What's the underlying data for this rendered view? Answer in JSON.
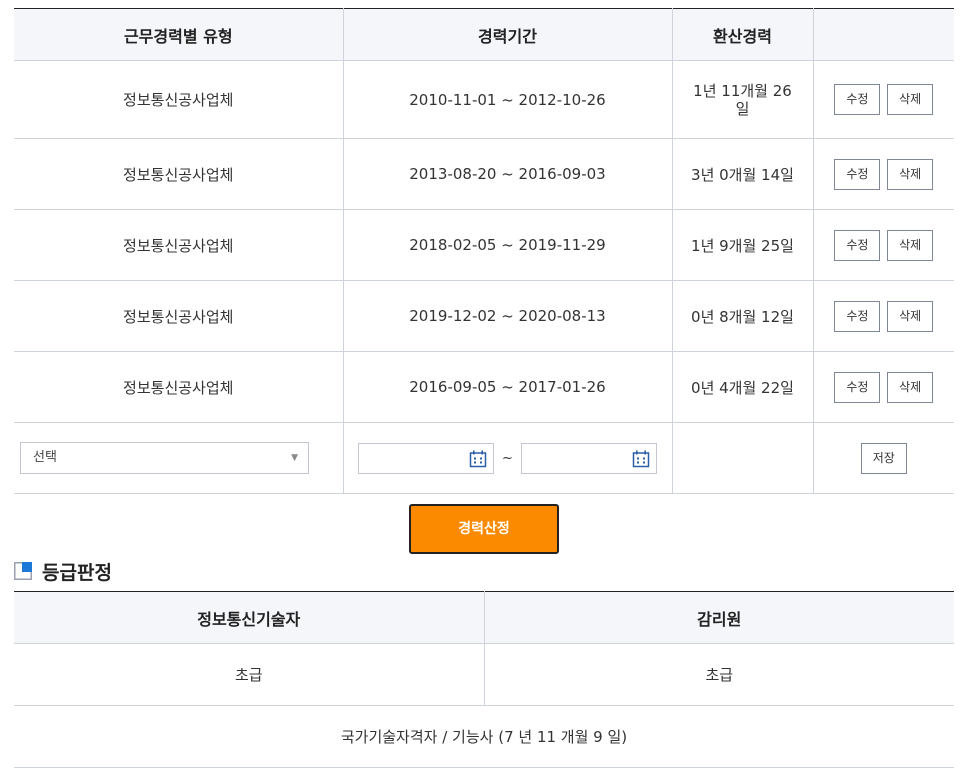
{
  "career_table": {
    "headers": [
      "근무경력별 유형",
      "경력기간",
      "환산경력",
      ""
    ],
    "rows": [
      {
        "type": "정보통신공사업체",
        "period": "2010-11-01 ~ 2012-10-26",
        "converted": "1년 11개월 26\n일"
      },
      {
        "type": "정보통신공사업체",
        "period": "2013-08-20 ~ 2016-09-03",
        "converted": "3년 0개월 14일"
      },
      {
        "type": "정보통신공사업체",
        "period": "2018-02-05 ~ 2019-11-29",
        "converted": "1년 9개월 25일"
      },
      {
        "type": "정보통신공사업체",
        "period": "2019-12-02 ~ 2020-08-13",
        "converted": "0년 8개월 12일"
      },
      {
        "type": "정보통신공사업체",
        "period": "2016-09-05 ~ 2017-01-26",
        "converted": "0년 4개월 22일"
      }
    ],
    "edit_label": "수정",
    "delete_label": "삭제",
    "new_row": {
      "select_value": "선택",
      "tilde": "~",
      "save_label": "저장"
    }
  },
  "calc_button": "경력산정",
  "grade_section": {
    "title": "등급판정",
    "headers": [
      "정보통신기술자",
      "감리원"
    ],
    "values": [
      "초급",
      "초급"
    ],
    "note": "국가기술자격자 / 기능사 (7 년 11 개월 9 일)"
  },
  "colors": {
    "accent": "#fb8a00",
    "header_bg": "#f5f6fa",
    "icon_blue": "#1e78d6"
  }
}
